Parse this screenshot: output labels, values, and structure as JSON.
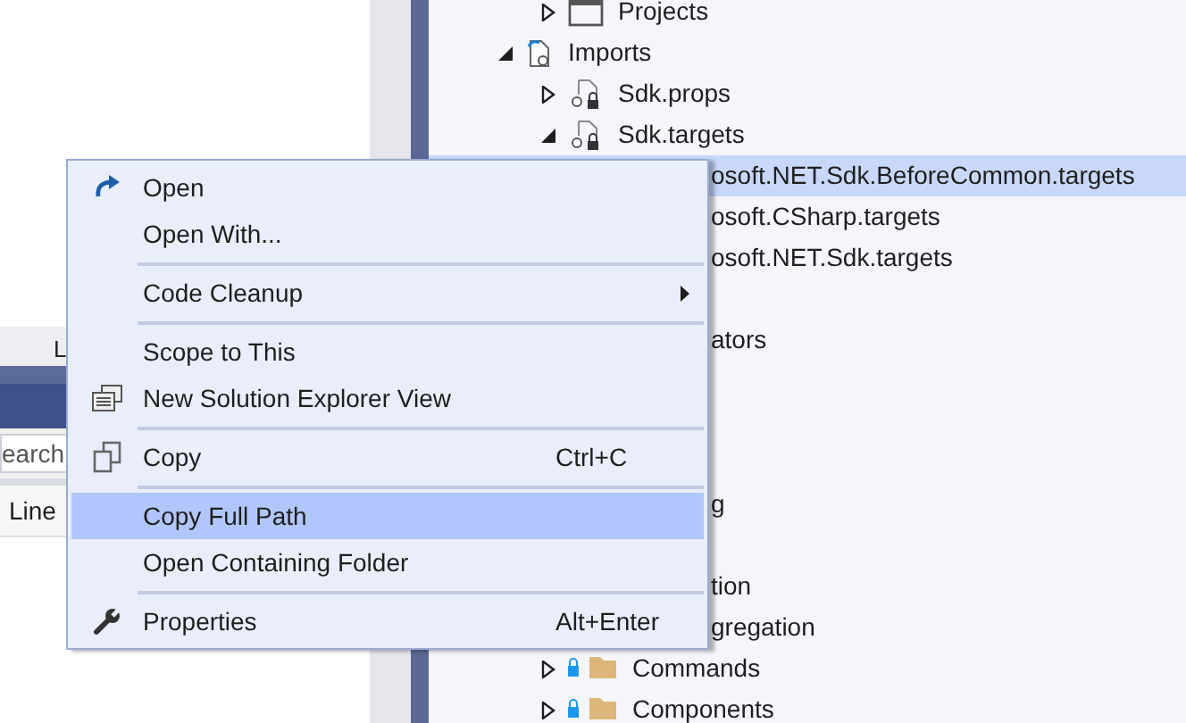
{
  "bottom_panel": {
    "tab_label": "L",
    "search": {
      "placeholder": "earch"
    },
    "column_header": "Line"
  },
  "tree": [
    {
      "kind": "offscreen",
      "children": [
        {
          "kind": "project",
          "label": "Projects",
          "expanded": false,
          "selected": false
        }
      ]
    },
    {
      "kind": "imports",
      "label": "Imports",
      "expanded": true,
      "selected": false,
      "children": [
        {
          "kind": "file",
          "label": "Sdk.props",
          "expanded": false,
          "selected": false
        },
        {
          "kind": "file",
          "label": "Sdk.targets",
          "expanded": true,
          "selected": false,
          "children": [
            {
              "kind": "clipped",
              "label": "osoft.NET.Sdk.BeforeCommon.targets",
              "selected": true
            },
            {
              "kind": "clipped",
              "label": "osoft.CSharp.targets",
              "selected": false
            },
            {
              "kind": "clipped",
              "label": "osoft.NET.Sdk.targets",
              "selected": false
            },
            {
              "kind": "covered"
            }
          ]
        }
      ]
    },
    {
      "kind": "clipped",
      "label": "ators",
      "selected": false
    },
    {
      "kind": "covered"
    },
    {
      "kind": "covered"
    },
    {
      "kind": "covered"
    },
    {
      "kind": "clipped",
      "label": "g",
      "selected": false
    },
    {
      "kind": "covered"
    },
    {
      "kind": "clipped",
      "label": "tion",
      "selected": false
    },
    {
      "kind": "clipped",
      "label": "gregation",
      "selected": false,
      "children": [
        {
          "kind": "folder",
          "label": "Commands",
          "expanded": false,
          "selected": false
        },
        {
          "kind": "folder",
          "label": "Components",
          "expanded": false,
          "selected": false
        }
      ]
    }
  ],
  "context_menu": [
    {
      "kind": "open",
      "label": "Open",
      "selected": false
    },
    {
      "kind": "item",
      "label": "Open With...",
      "selected": false
    },
    {
      "kind": "separator"
    },
    {
      "kind": "item",
      "label": "Code Cleanup",
      "submenu": true,
      "selected": false
    },
    {
      "kind": "separator"
    },
    {
      "kind": "item",
      "label": "Scope to This",
      "selected": false
    },
    {
      "kind": "view",
      "label": "New Solution Explorer View",
      "selected": false
    },
    {
      "kind": "separator"
    },
    {
      "kind": "copy",
      "label": "Copy",
      "shortcut": "Ctrl+C",
      "selected": false
    },
    {
      "kind": "separator"
    },
    {
      "kind": "item",
      "label": "Copy Full Path",
      "selected": true
    },
    {
      "kind": "item",
      "label": "Open Containing Folder",
      "selected": false
    },
    {
      "kind": "separator"
    },
    {
      "kind": "properties",
      "label": "Properties",
      "shortcut": "Alt+Enter",
      "selected": false
    }
  ]
}
